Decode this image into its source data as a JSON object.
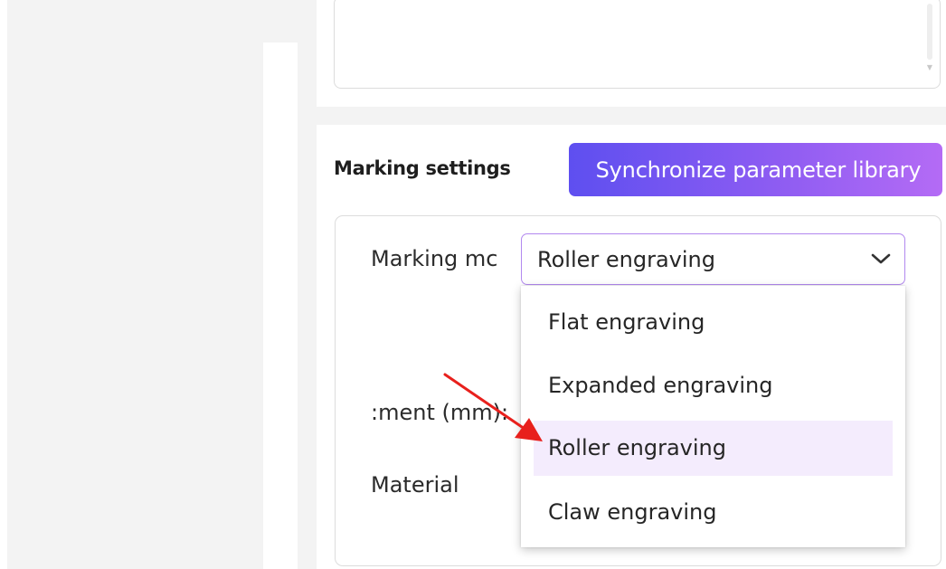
{
  "settings": {
    "section_title": "Marking settings",
    "sync_button_label": "Synchronize parameter library"
  },
  "form": {
    "marking_mode_label": "Marking mc",
    "adjustment_label": ":ment (mm):",
    "material_label": "Material",
    "marking_mode_value": "Roller engraving"
  },
  "dropdown": {
    "options": [
      {
        "label": "Flat engraving",
        "selected": false
      },
      {
        "label": "Expanded engraving",
        "selected": false
      },
      {
        "label": "Roller engraving",
        "selected": true
      },
      {
        "label": "Claw engraving",
        "selected": false
      }
    ]
  },
  "colors": {
    "accent_start": "#5e4ff0",
    "accent_end": "#b46bf5",
    "select_border": "#b288ef",
    "selected_option_bg": "#f4ecfd",
    "annotation_arrow": "#e8201c"
  },
  "icons": {
    "select_toggle": "chevron-down-icon",
    "annotation": "red-arrow-annotation"
  }
}
